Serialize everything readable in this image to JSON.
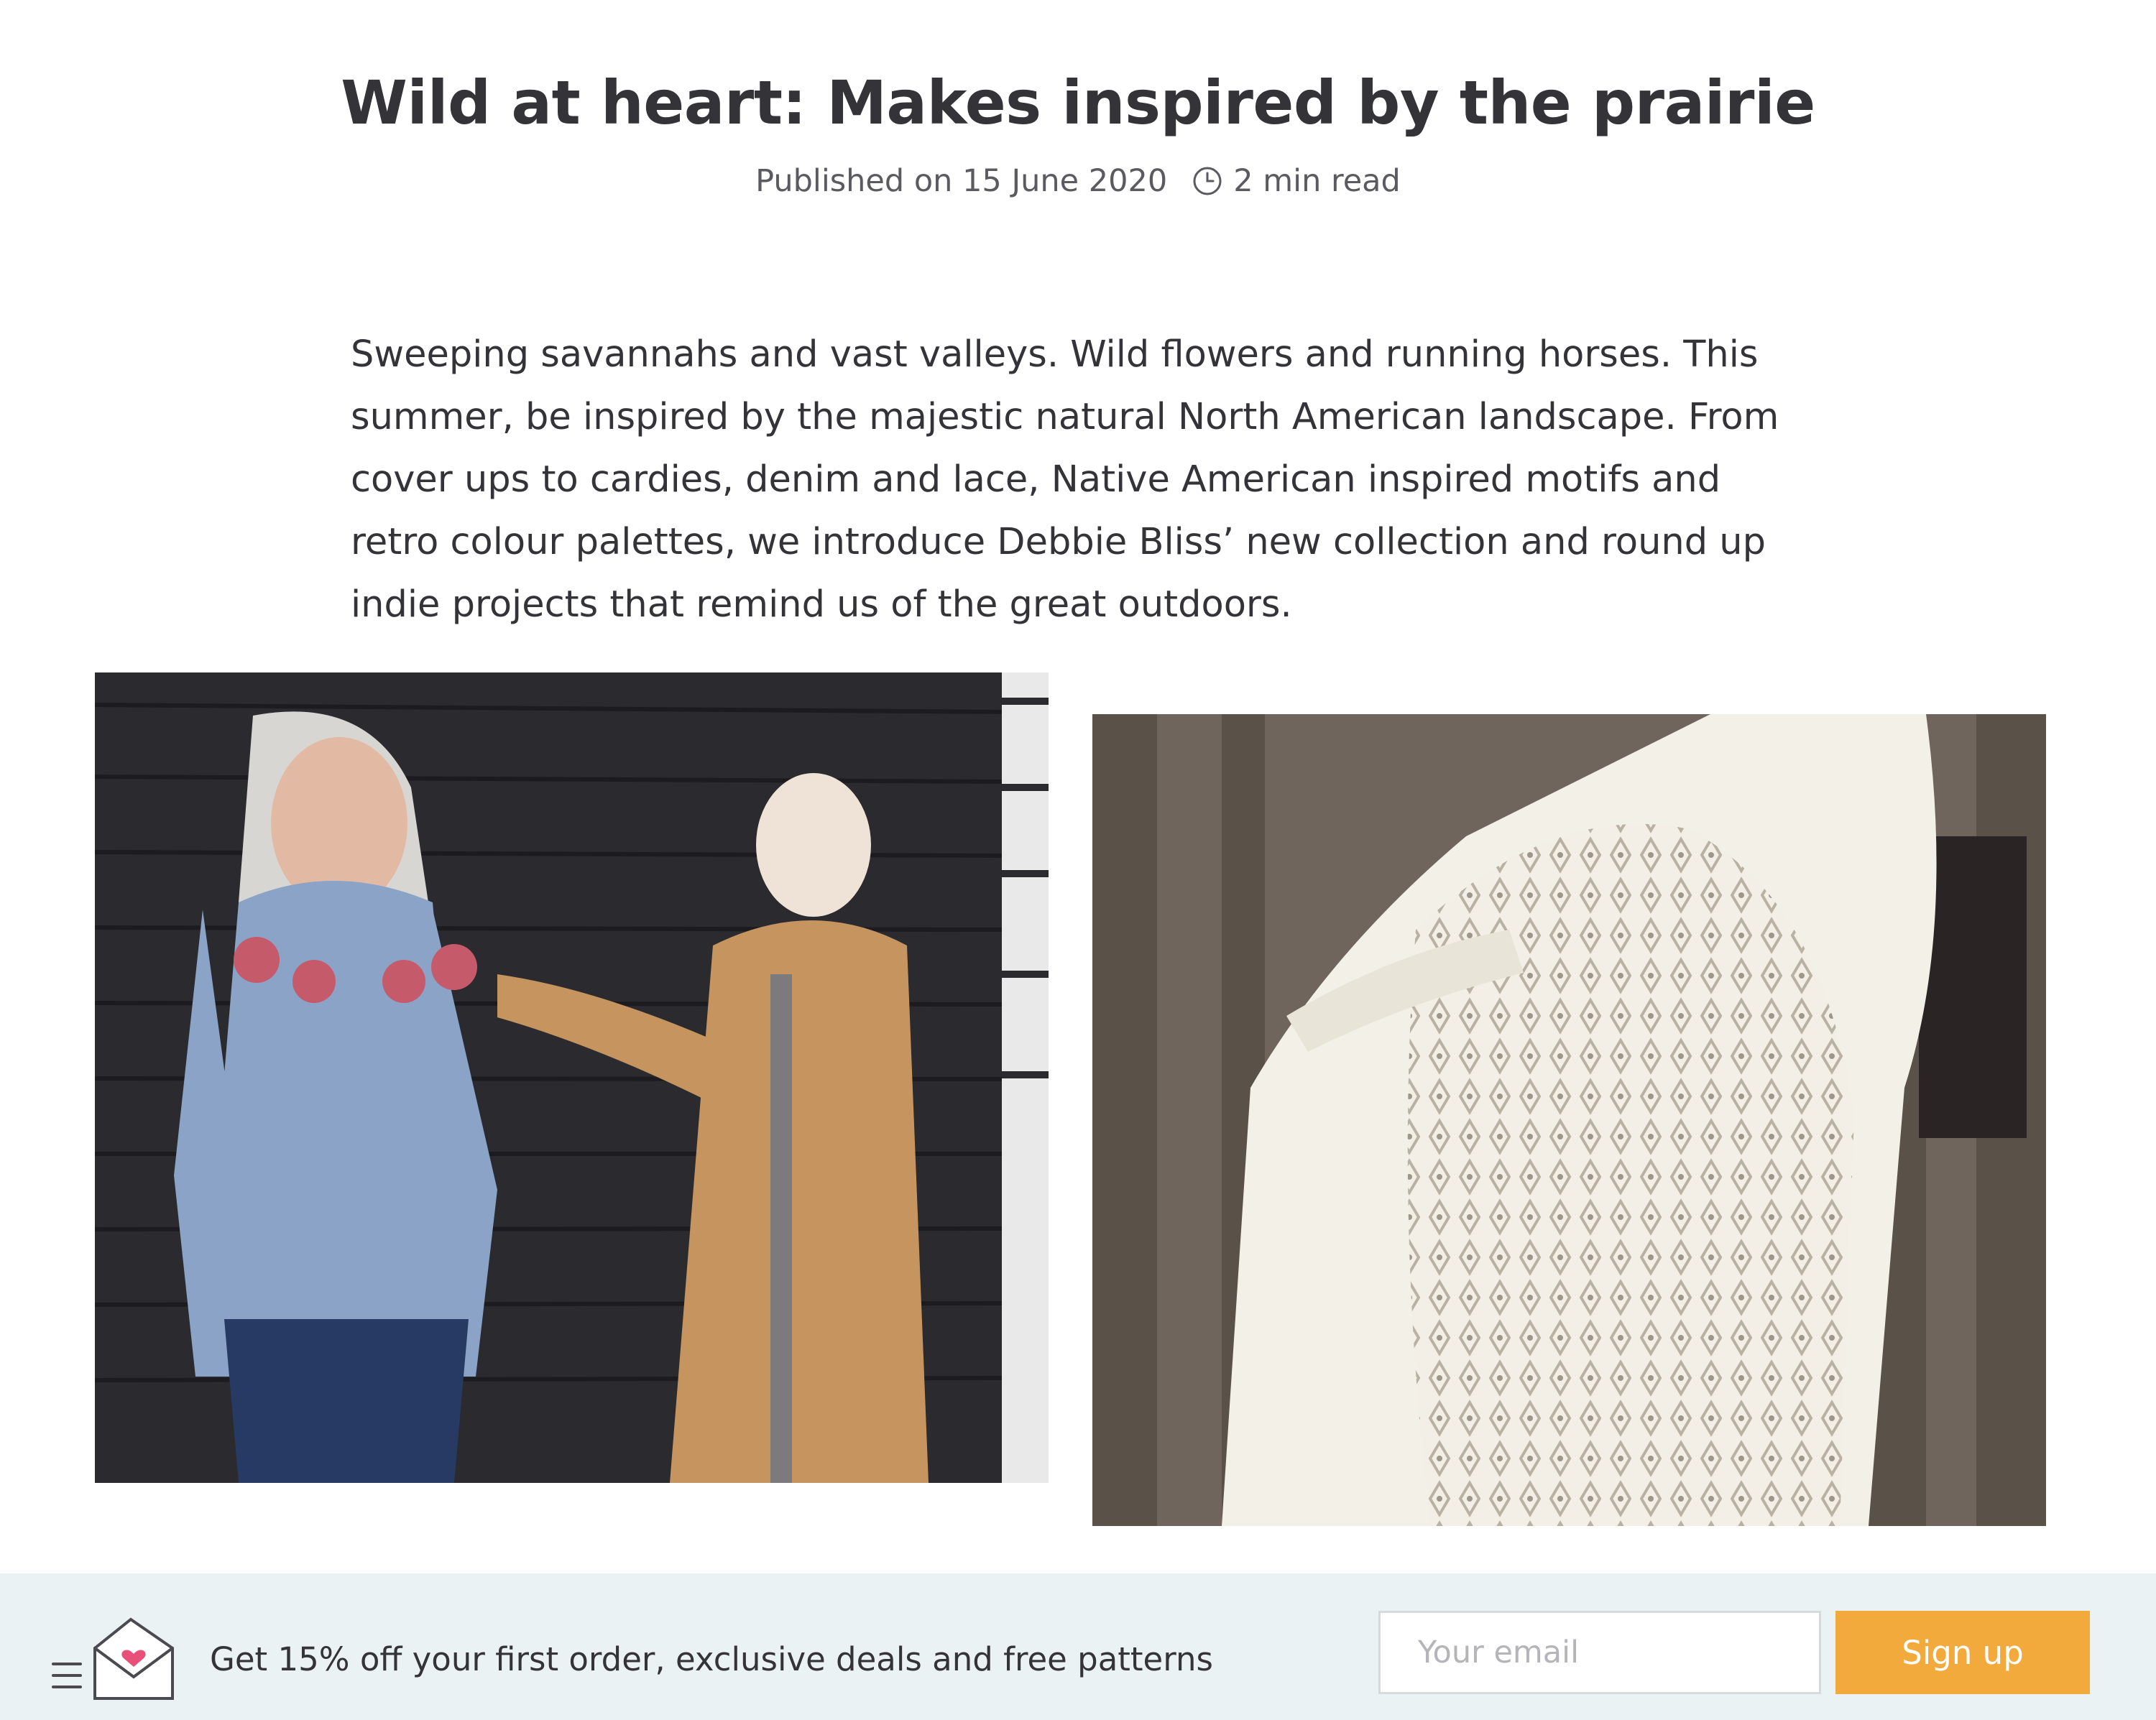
{
  "article": {
    "title": "Wild at heart: Makes inspired by the prairie",
    "published": "Published on 15 June 2020",
    "read_time": "2 min read",
    "intro": "Sweeping savannahs and vast valleys. Wild flowers and running horses. This summer, be inspired by the majestic natural North American landscape. From cover ups to cardies, denim and lace, Native American inspired motifs and retro colour palettes, we introduce Debbie Bliss’ new collection and round up indie projects that remind us of the great outdoors."
  },
  "icons": {
    "clock": "clock-icon",
    "mail": "envelope-heart-icon"
  },
  "newsletter": {
    "promo_text": "Get 15% off your first order, exclusive deals and free patterns",
    "email_placeholder": "Your email",
    "signup_label": "Sign up"
  },
  "colors": {
    "footer_bg": "#eaf2f3",
    "signup_button": "#f3aa3c",
    "heart": "#e8507a"
  }
}
